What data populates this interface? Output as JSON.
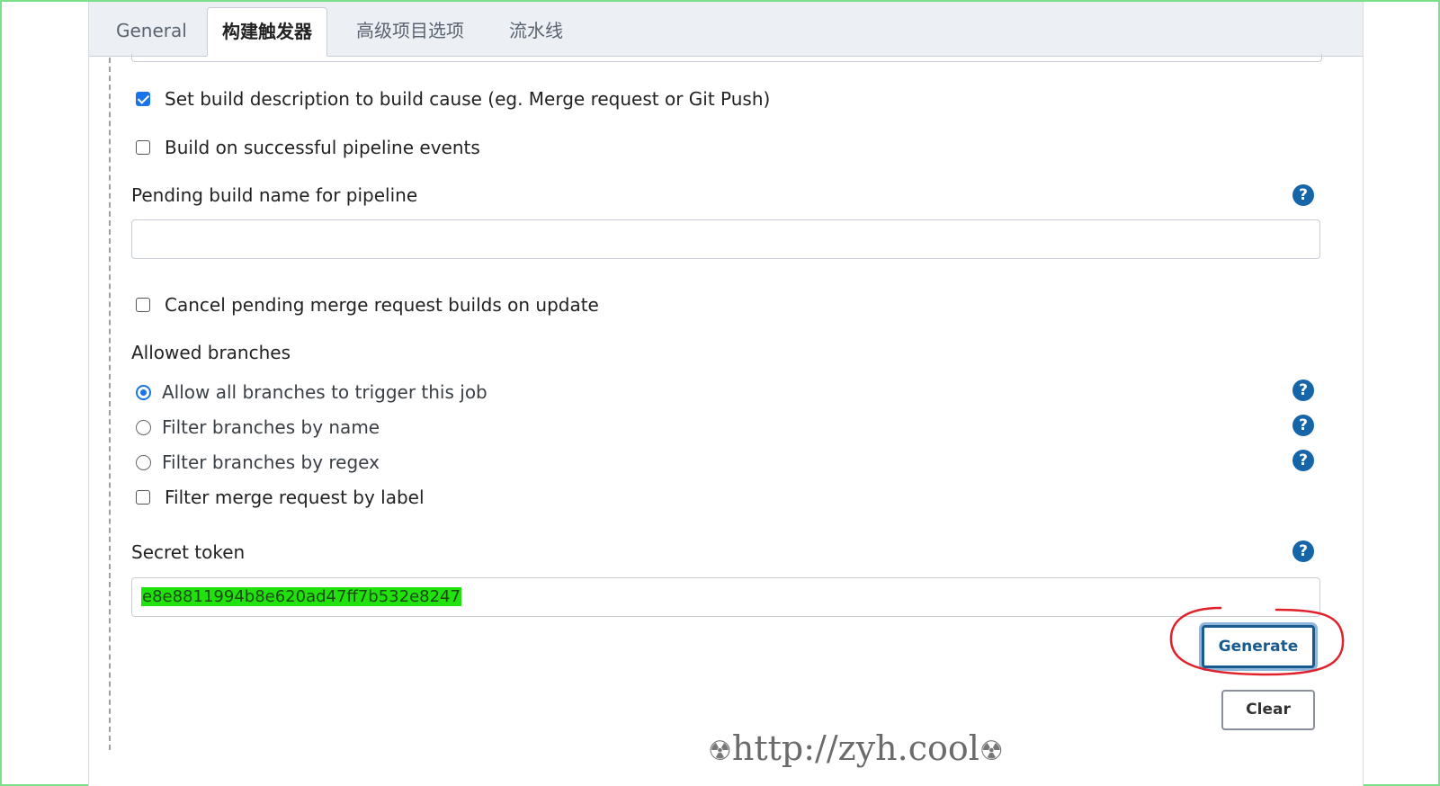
{
  "tabs": [
    {
      "label": "General",
      "active": false
    },
    {
      "label": "构建触发器",
      "active": true
    },
    {
      "label": "高级项目选项",
      "active": false
    },
    {
      "label": "流水线",
      "active": false
    }
  ],
  "options": {
    "set_build_description": {
      "label": "Set build description to build cause (eg. Merge request or Git Push)",
      "checked": true
    },
    "build_on_pipeline_events": {
      "label": "Build on successful pipeline events",
      "checked": false
    },
    "cancel_pending": {
      "label": "Cancel pending merge request builds on update",
      "checked": false
    },
    "filter_by_label": {
      "label": "Filter merge request by label",
      "checked": false
    }
  },
  "pending_build_name": {
    "label": "Pending build name for pipeline",
    "value": ""
  },
  "allowed_branches": {
    "title": "Allowed branches",
    "choices": [
      {
        "label": "Allow all branches to trigger this job",
        "selected": true
      },
      {
        "label": "Filter branches by name",
        "selected": false
      },
      {
        "label": "Filter branches by regex",
        "selected": false
      }
    ]
  },
  "secret_token": {
    "label": "Secret token",
    "value": "e8e8811994b8e620ad47ff7b532e8247"
  },
  "buttons": {
    "generate": "Generate",
    "clear": "Clear"
  },
  "help_glyph": "?",
  "watermark": {
    "text": "http://zyh.cool",
    "glyph": "☢"
  },
  "colors": {
    "accent": "#1a73e8",
    "help": "#1565a8",
    "token_highlight": "#22e20e",
    "annotation": "#e0202a"
  }
}
